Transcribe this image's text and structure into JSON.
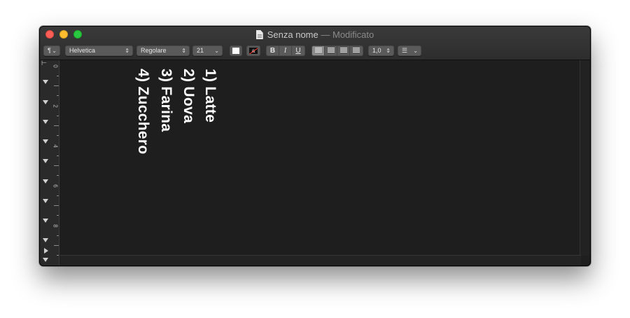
{
  "window": {
    "title": "Senza nome",
    "title_separator": "—",
    "title_status": "Modificato"
  },
  "toolbar": {
    "paragraph_style_label": "¶",
    "font_family": "Helvetica",
    "font_style": "Regolare",
    "font_size": "21",
    "text_color": "#ffffff",
    "background_color_glyph": "a",
    "bold_label": "B",
    "italic_label": "I",
    "underline_label": "U",
    "line_spacing": "1,0",
    "list_label": "☰",
    "selected_alignment": "left"
  },
  "ruler": {
    "labels": [
      "0",
      "2",
      "4",
      "6",
      "8"
    ]
  },
  "document": {
    "lines": [
      "1) Latte",
      "2) Uova",
      "3) Farina",
      "4) Zucchero"
    ]
  },
  "colors": {
    "close": "#fd5f57",
    "minimize": "#febc2e",
    "zoom": "#29c840",
    "editor_bg": "#1e1e1e",
    "text": "#ffffff"
  }
}
